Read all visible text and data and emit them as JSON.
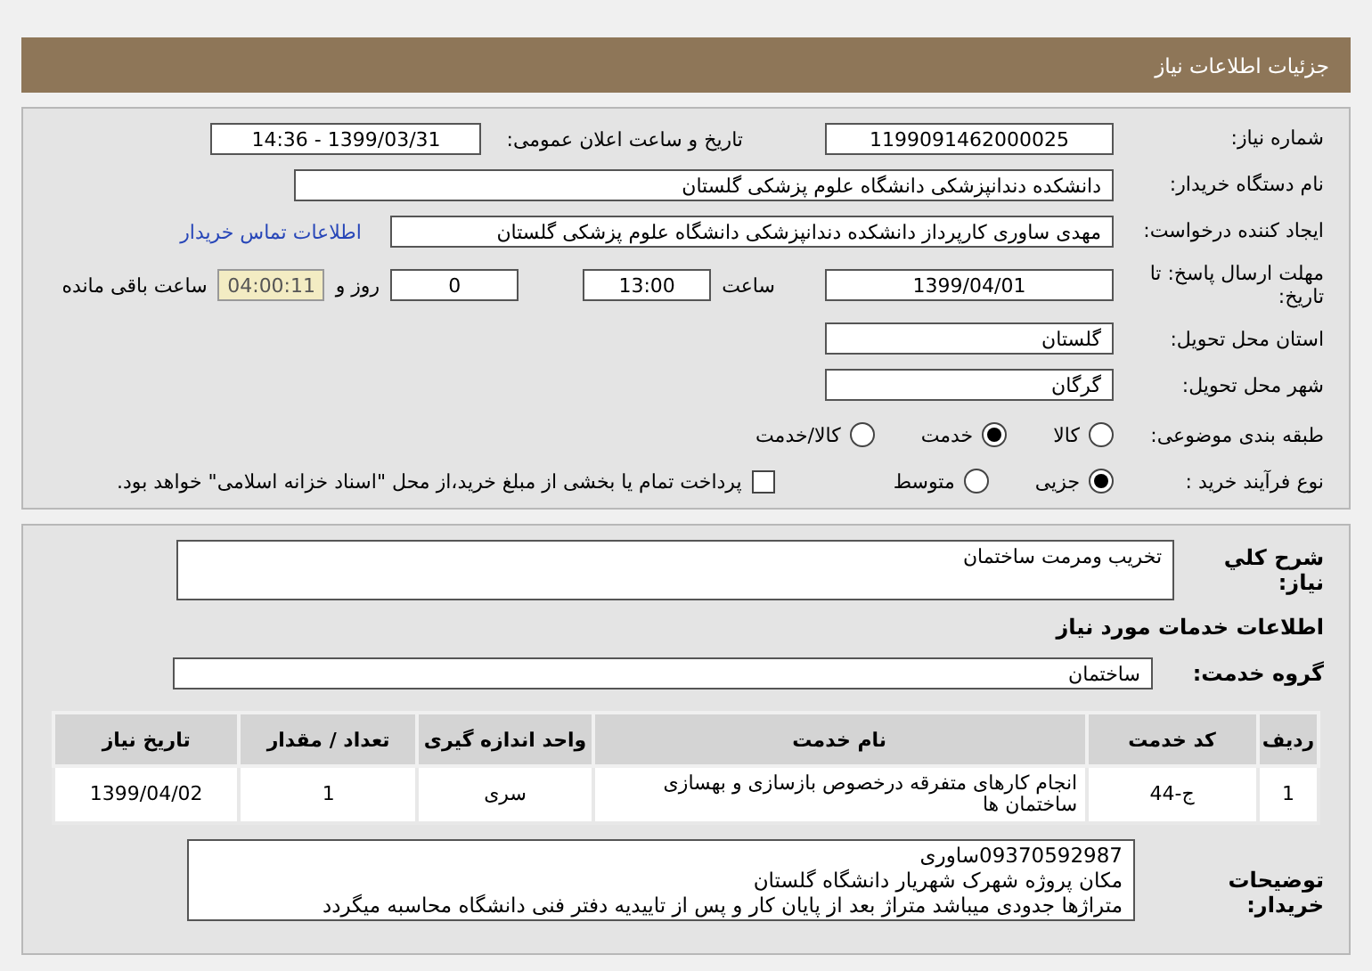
{
  "title": "جزئیات اطلاعات نیاز",
  "need_number": {
    "label": "شماره نیاز:",
    "value": "1199091462000025"
  },
  "announce": {
    "label": "تاریخ و ساعت اعلان عمومی:",
    "value": "1399/03/31 - 14:36"
  },
  "buyer": {
    "label": "نام دستگاه خریدار:",
    "value": "دانشکده دندانپزشکی دانشگاه علوم پزشکی گلستان"
  },
  "creator": {
    "label": "ایجاد کننده درخواست:",
    "value": "مهدی ساوری کارپرداز دانشکده دندانپزشکی دانشگاه علوم پزشکی گلستان",
    "link": "اطلاعات تماس خریدار"
  },
  "deadline": {
    "label": "مهلت ارسال پاسخ: تا تاریخ:",
    "date": "1399/04/01",
    "time_label": "ساعت",
    "time": "13:00",
    "days": "0",
    "days_label": "روز و",
    "remaining": "04:00:11",
    "remaining_label": "ساعت باقی مانده"
  },
  "province": {
    "label": "استان محل تحویل:",
    "value": "گلستان"
  },
  "city": {
    "label": "شهر محل تحویل:",
    "value": "گرگان"
  },
  "category": {
    "label": "طبقه بندی موضوعی:",
    "options": [
      {
        "label": "کالا",
        "selected": false
      },
      {
        "label": "خدمت",
        "selected": true
      },
      {
        "label": "کالا/خدمت",
        "selected": false
      }
    ]
  },
  "process": {
    "label": "نوع فرآیند خرید :",
    "options": [
      {
        "label": "جزیی",
        "selected": true
      },
      {
        "label": "متوسط",
        "selected": false
      }
    ],
    "payment": {
      "label": "پرداخت تمام یا بخشی از مبلغ خرید،از محل \"اسناد خزانه اسلامی\" خواهد بود.",
      "checked": false
    }
  },
  "description": {
    "label": "شرح کلي نياز:",
    "value": "تخریب ومرمت ساختمان"
  },
  "section_title": "اطلاعات خدمات مورد نیاز",
  "service_group": {
    "label": "گروه خدمت:",
    "value": "ساختمان"
  },
  "table": {
    "columns": [
      "ردیف",
      "کد خدمت",
      "نام خدمت",
      "واحد اندازه گیری",
      "تعداد / مقدار",
      "تاریخ نیاز"
    ],
    "rows": [
      [
        "1",
        "ج-44",
        "انجام کارهای متفرقه درخصوص بازسازی و بهسازی ساختمان ها",
        "سری",
        "1",
        "1399/04/02"
      ]
    ]
  },
  "notes": {
    "label": "توضیحات خریدار:",
    "lines": [
      "09370592987ساوری",
      "مکان پروژه شهرک شهریار دانشگاه گلستان",
      "متراژها جدودی میباشد متراژ بعد از پایان کار و پس از تاییدیه دفتر فنی دانشگاه محاسبه میگردد"
    ]
  }
}
